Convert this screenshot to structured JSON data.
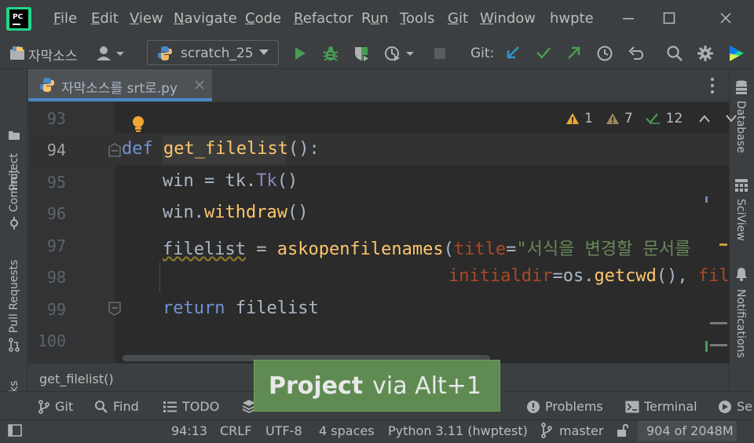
{
  "menu": {
    "items": [
      {
        "pre": "",
        "u": "F",
        "post": "ile"
      },
      {
        "pre": "",
        "u": "E",
        "post": "dit"
      },
      {
        "pre": "",
        "u": "V",
        "post": "iew"
      },
      {
        "pre": "",
        "u": "N",
        "post": "avigate"
      },
      {
        "pre": "",
        "u": "C",
        "post": "ode"
      },
      {
        "pre": "",
        "u": "R",
        "post": "efactor"
      },
      {
        "pre": "R",
        "u": "u",
        "post": "n"
      },
      {
        "pre": "",
        "u": "T",
        "post": "ools"
      },
      {
        "pre": "",
        "u": "G",
        "post": "it"
      },
      {
        "pre": "",
        "u": "W",
        "post": "indow"
      }
    ],
    "title_fragment": "hwpte"
  },
  "toolbar": {
    "project_name": "자막소스",
    "run_config": "scratch_25",
    "git_label": "Git:"
  },
  "tab": {
    "filename": "자막소스를 srt로.py"
  },
  "inspections": {
    "warnings": "1",
    "weak_warnings": "7",
    "typos": "12"
  },
  "editor": {
    "line_numbers": [
      "93",
      "94",
      "95",
      "96",
      "97",
      "98",
      "99",
      "100"
    ],
    "code": {
      "l94_kw": "def",
      "l94_fn": "get_filelist",
      "l94_rest": "():",
      "l95_a": "win = tk.",
      "l95_b": "Tk",
      "l95_c": "()",
      "l96_a": "win.",
      "l96_b": "withdraw",
      "l96_c": "()",
      "l97_a": "filelist",
      "l97_b": " = ",
      "l97_c": "askopenfilenames",
      "l97_d": "(",
      "l97_e": "title",
      "l97_f": "=",
      "l97_g": "\"서식을 변경할 문서를",
      "l98_a": "initialdir",
      "l98_b": "=os.",
      "l98_c": "getcwd",
      "l98_d": "(), ",
      "l98_e": "fil",
      "l99_kw": "return",
      "l99_rest": " filelist"
    }
  },
  "breadcrumb": "get_filelist()",
  "popup": {
    "bold": "Project",
    "rest": "via Alt+1"
  },
  "left_tools": [
    "Project",
    "Commit",
    "Pull Requests",
    "ks"
  ],
  "right_tools": [
    "Database",
    "SciView",
    "Notifications"
  ],
  "bottom_tools": {
    "git": "Git",
    "find": "Find",
    "todo": "TODO",
    "problems": "Problems",
    "terminal": "Terminal",
    "services": "Se"
  },
  "status": {
    "position": "94:13",
    "line_sep": "CRLF",
    "encoding": "UTF-8",
    "indent": "4 spaces",
    "interpreter": "Python 3.11 (hwptest)",
    "branch": "master",
    "memory": "904 of 2048M"
  }
}
